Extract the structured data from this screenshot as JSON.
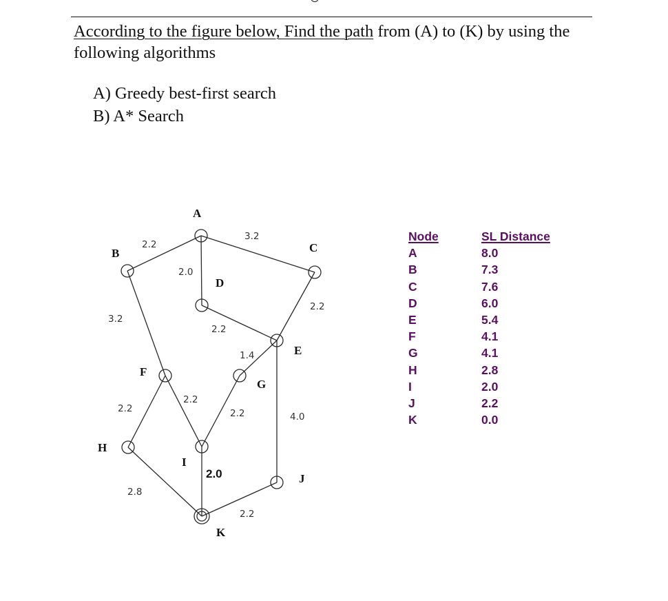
{
  "question": {
    "underlined_part": "According to the figure below, Find the path",
    "rest_part": " from (A) to (K) by using the following algorithms"
  },
  "options": [
    {
      "label": "A) Greedy best-first search"
    },
    {
      "label": "B) A* Search"
    }
  ],
  "graph": {
    "nodes": [
      {
        "id": "A",
        "label": "A"
      },
      {
        "id": "B",
        "label": "B"
      },
      {
        "id": "C",
        "label": "C"
      },
      {
        "id": "D",
        "label": "D"
      },
      {
        "id": "E",
        "label": "E"
      },
      {
        "id": "F",
        "label": "F"
      },
      {
        "id": "G",
        "label": "G"
      },
      {
        "id": "H",
        "label": "H"
      },
      {
        "id": "I",
        "label": "I"
      },
      {
        "id": "J",
        "label": "J"
      },
      {
        "id": "K",
        "label": "K",
        "goal": true
      }
    ],
    "edges": [
      {
        "from": "A",
        "to": "B",
        "weight": "2.2"
      },
      {
        "from": "A",
        "to": "C",
        "weight": "3.2"
      },
      {
        "from": "A",
        "to": "D",
        "weight": "2.0"
      },
      {
        "from": "C",
        "to": "E",
        "weight": "2.2"
      },
      {
        "from": "D",
        "to": "E",
        "weight": "2.2"
      },
      {
        "from": "B",
        "to": "F",
        "weight": "3.2"
      },
      {
        "from": "E",
        "to": "G",
        "weight": "1.4"
      },
      {
        "from": "E",
        "to": "J",
        "weight": "4.0"
      },
      {
        "from": "F",
        "to": "H",
        "weight": "2.2"
      },
      {
        "from": "F",
        "to": "I",
        "weight": "2.2"
      },
      {
        "from": "G",
        "to": "I",
        "weight": "2.2"
      },
      {
        "from": "H",
        "to": "K",
        "weight": "2.8"
      },
      {
        "from": "I",
        "to": "K",
        "weight": "2.0"
      },
      {
        "from": "J",
        "to": "K",
        "weight": "2.2"
      }
    ]
  },
  "sl_table": {
    "header_node": "Node",
    "header_distance": "SL Distance",
    "text_color": "#5a1060",
    "rows": [
      {
        "node": "A",
        "distance": "8.0"
      },
      {
        "node": "B",
        "distance": "7.3"
      },
      {
        "node": "C",
        "distance": "7.6"
      },
      {
        "node": "D",
        "distance": "6.0"
      },
      {
        "node": "E",
        "distance": "5.4"
      },
      {
        "node": "F",
        "distance": "4.1"
      },
      {
        "node": "G",
        "distance": "4.1"
      },
      {
        "node": "H",
        "distance": "2.8"
      },
      {
        "node": "I",
        "distance": "2.0"
      },
      {
        "node": "J",
        "distance": "2.2"
      },
      {
        "node": "K",
        "distance": "0.0"
      }
    ]
  }
}
